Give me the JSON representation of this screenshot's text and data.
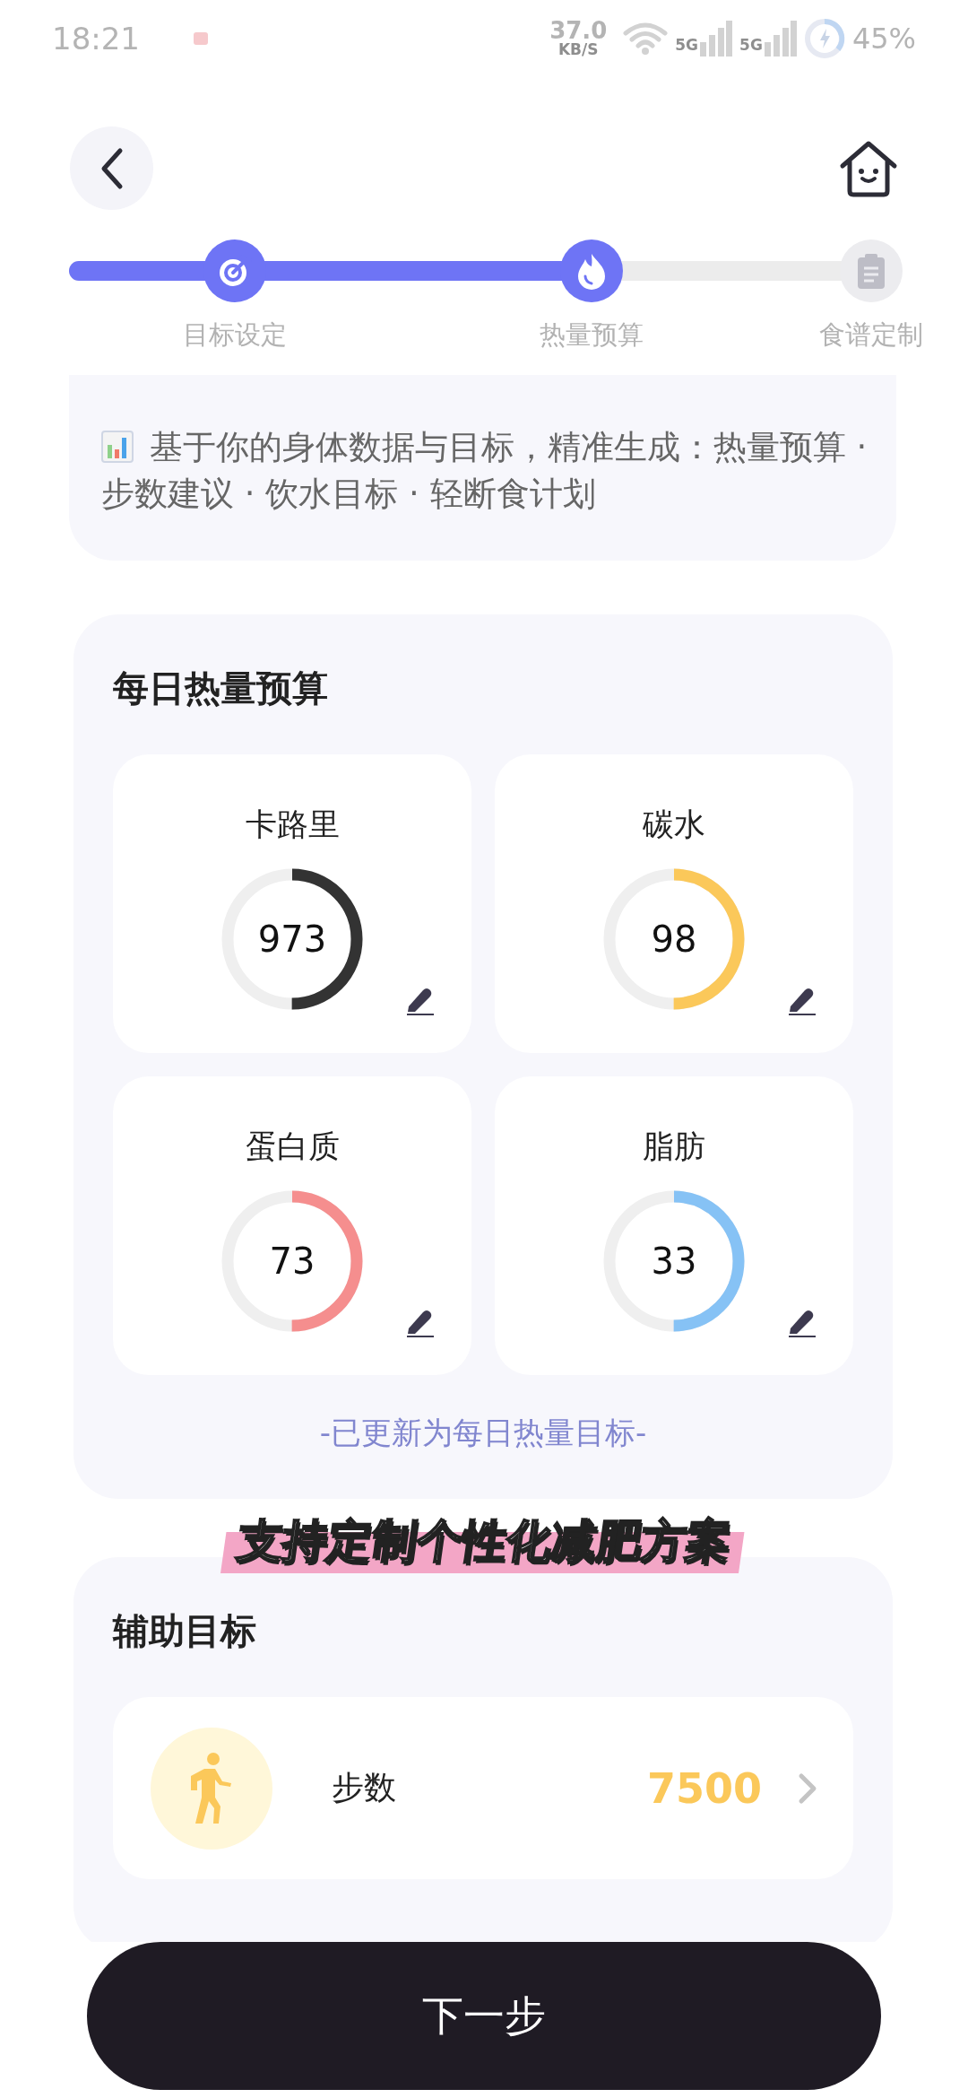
{
  "status_bar": {
    "time": "18:21",
    "speed": "37.0",
    "speed_unit": "KB/S",
    "network_1": "5G",
    "network_2": "5G",
    "battery": "45%"
  },
  "stepper": {
    "level": 0.63,
    "steps": [
      {
        "label": "目标设定",
        "kind": "target",
        "done": true
      },
      {
        "label": "热量预算",
        "kind": "flame",
        "done": true
      },
      {
        "label": "食谱定制",
        "kind": "clipboard",
        "done": false
      }
    ]
  },
  "intro": {
    "text": "基于你的身体数据与目标，精准生成：热量预算 · 步数建议 · 饮水目标 · 轻断食计划"
  },
  "budget": {
    "title": "每日热量预算",
    "items": [
      {
        "label": "卡路里",
        "value": "973",
        "level": 0.5,
        "color": "#333333"
      },
      {
        "label": "碳水",
        "value": "98",
        "level": 0.5,
        "color": "#fbc85a"
      },
      {
        "label": "蛋白质",
        "value": "73",
        "level": 0.5,
        "color": "#f58e8e"
      },
      {
        "label": "脂肪",
        "value": "33",
        "level": 0.5,
        "color": "#86c2f5"
      }
    ],
    "note": "-已更新为每日热量目标-"
  },
  "caption": "支持定制个性化减肥方案",
  "aux": {
    "title": "辅助目标",
    "items": [
      {
        "label": "步数",
        "value": "7500",
        "kind": "steps"
      }
    ]
  },
  "next_button": "下一步"
}
